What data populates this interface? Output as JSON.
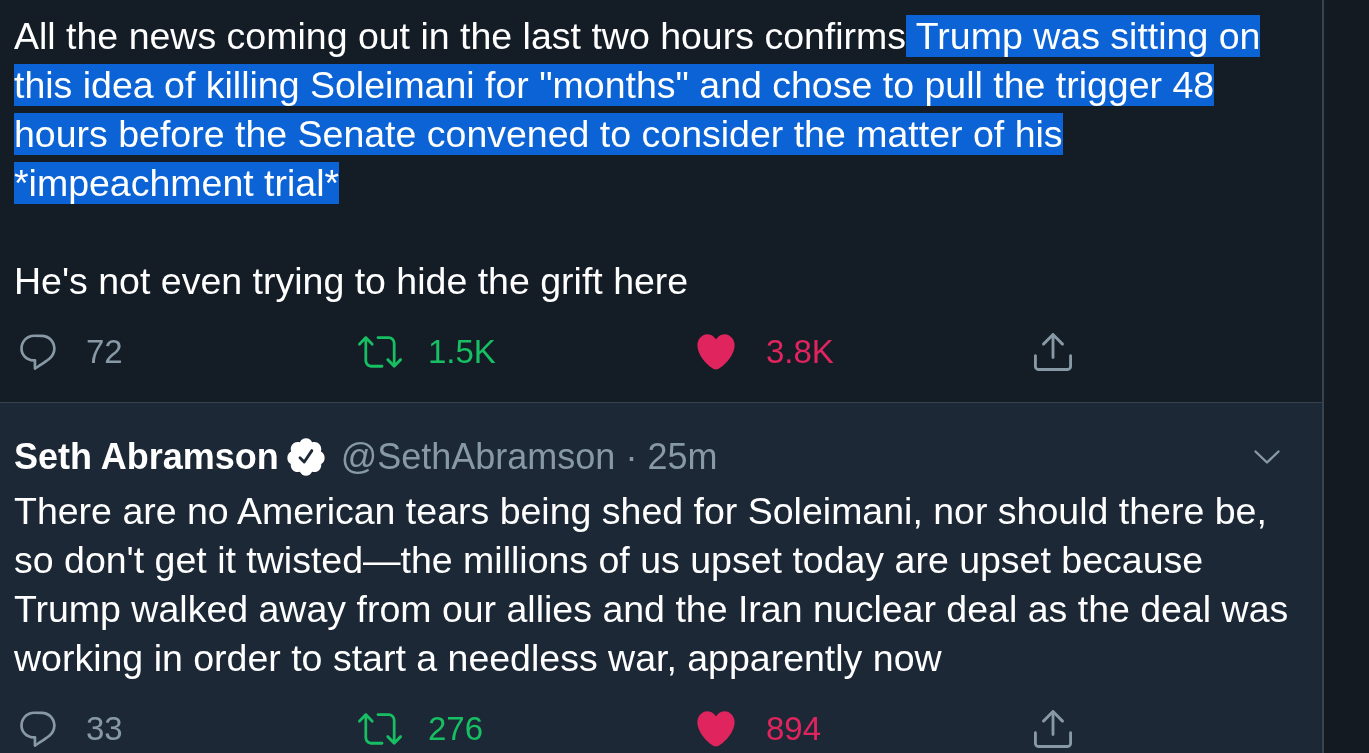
{
  "tweets": [
    {
      "hovered": false,
      "paragraphs": [
        {
          "segments": [
            {
              "text": "All the news coming out in the last two hours confirms",
              "selected": false
            },
            {
              "text": " Trump was sitting on this idea of killing Soleimani for \"months\" and chose to pull the trigger 48 hours before the Senate convened to consider the matter of his *impeachment trial*",
              "selected": true
            }
          ]
        },
        {
          "segments": [
            {
              "text": "He's not even trying to hide the grift here",
              "selected": false
            }
          ]
        }
      ],
      "actions": {
        "replies": "72",
        "retweets": "1.5K",
        "retweeted": true,
        "likes": "3.8K",
        "liked": true
      }
    },
    {
      "hovered": true,
      "author": {
        "name": "Seth Abramson",
        "verified": true,
        "handle": "@SethAbramson",
        "separator": "·",
        "time": "25m"
      },
      "paragraphs": [
        {
          "segments": [
            {
              "text": "There are no American tears being shed for Soleimani, nor should there be, so don't get it twisted—the millions of us upset today are upset because Trump walked away from our allies and the Iran nuclear deal as the deal was working in order to start a needless war, apparently now",
              "selected": false
            }
          ]
        }
      ],
      "actions": {
        "replies": "33",
        "retweets": "276",
        "retweeted": true,
        "likes": "894",
        "liked": true
      }
    }
  ]
}
